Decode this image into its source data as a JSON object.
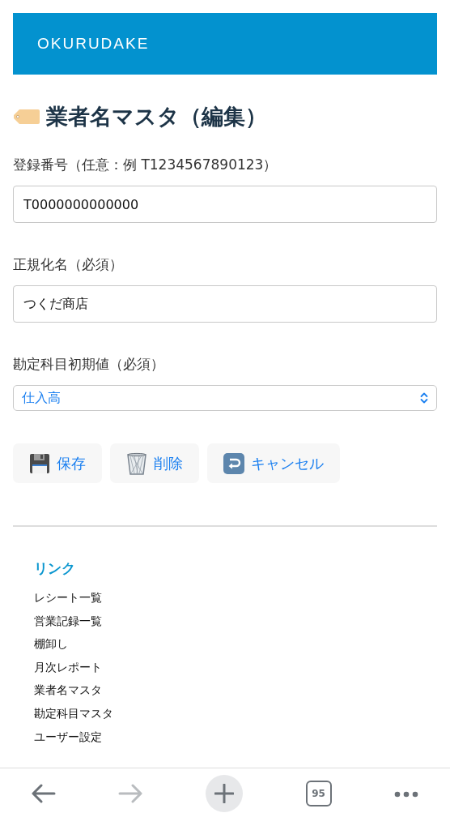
{
  "header": {
    "brand": "OKURUDAKE"
  },
  "page_title": "業者名マスタ（編集）",
  "fields": [
    {
      "kind": "text",
      "label": "登録番号（任意：例 T1234567890123）",
      "value": "T0000000000000"
    },
    {
      "kind": "text",
      "label": "正規化名（必須）",
      "value": "つくだ商店"
    },
    {
      "kind": "select",
      "label": "勘定科目初期値（必須）",
      "value": "仕入高"
    }
  ],
  "buttons": [
    {
      "kind": "save",
      "label": "保存"
    },
    {
      "kind": "delete",
      "label": "削除"
    },
    {
      "kind": "cancel",
      "label": "キャンセル"
    }
  ],
  "links": {
    "title": "リンク",
    "items": [
      "レシート一覧",
      "営業記録一覧",
      "棚卸し",
      "月次レポート",
      "業者名マスタ",
      "勘定科目マスタ",
      "ユーザー設定"
    ]
  },
  "toolbar": {
    "back": {
      "disabled": false
    },
    "forward": {
      "disabled": true
    },
    "tab_count": "95"
  }
}
